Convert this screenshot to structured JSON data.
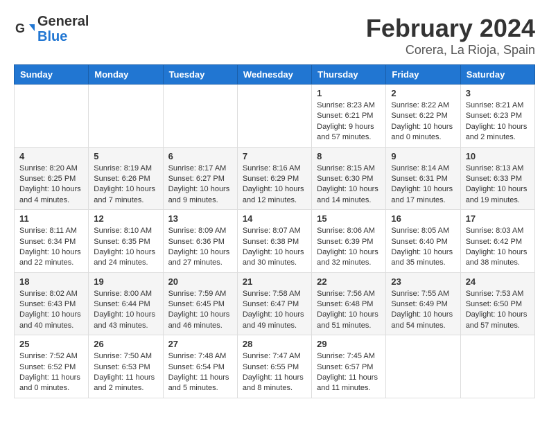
{
  "logo": {
    "line1": "General",
    "line2": "Blue"
  },
  "title": "February 2024",
  "subtitle": "Corera, La Rioja, Spain",
  "days_of_week": [
    "Sunday",
    "Monday",
    "Tuesday",
    "Wednesday",
    "Thursday",
    "Friday",
    "Saturday"
  ],
  "weeks": [
    [
      {
        "date": "",
        "info": ""
      },
      {
        "date": "",
        "info": ""
      },
      {
        "date": "",
        "info": ""
      },
      {
        "date": "",
        "info": ""
      },
      {
        "date": "1",
        "info": "Sunrise: 8:23 AM\nSunset: 6:21 PM\nDaylight: 9 hours and 57 minutes."
      },
      {
        "date": "2",
        "info": "Sunrise: 8:22 AM\nSunset: 6:22 PM\nDaylight: 10 hours and 0 minutes."
      },
      {
        "date": "3",
        "info": "Sunrise: 8:21 AM\nSunset: 6:23 PM\nDaylight: 10 hours and 2 minutes."
      }
    ],
    [
      {
        "date": "4",
        "info": "Sunrise: 8:20 AM\nSunset: 6:25 PM\nDaylight: 10 hours and 4 minutes."
      },
      {
        "date": "5",
        "info": "Sunrise: 8:19 AM\nSunset: 6:26 PM\nDaylight: 10 hours and 7 minutes."
      },
      {
        "date": "6",
        "info": "Sunrise: 8:17 AM\nSunset: 6:27 PM\nDaylight: 10 hours and 9 minutes."
      },
      {
        "date": "7",
        "info": "Sunrise: 8:16 AM\nSunset: 6:29 PM\nDaylight: 10 hours and 12 minutes."
      },
      {
        "date": "8",
        "info": "Sunrise: 8:15 AM\nSunset: 6:30 PM\nDaylight: 10 hours and 14 minutes."
      },
      {
        "date": "9",
        "info": "Sunrise: 8:14 AM\nSunset: 6:31 PM\nDaylight: 10 hours and 17 minutes."
      },
      {
        "date": "10",
        "info": "Sunrise: 8:13 AM\nSunset: 6:33 PM\nDaylight: 10 hours and 19 minutes."
      }
    ],
    [
      {
        "date": "11",
        "info": "Sunrise: 8:11 AM\nSunset: 6:34 PM\nDaylight: 10 hours and 22 minutes."
      },
      {
        "date": "12",
        "info": "Sunrise: 8:10 AM\nSunset: 6:35 PM\nDaylight: 10 hours and 24 minutes."
      },
      {
        "date": "13",
        "info": "Sunrise: 8:09 AM\nSunset: 6:36 PM\nDaylight: 10 hours and 27 minutes."
      },
      {
        "date": "14",
        "info": "Sunrise: 8:07 AM\nSunset: 6:38 PM\nDaylight: 10 hours and 30 minutes."
      },
      {
        "date": "15",
        "info": "Sunrise: 8:06 AM\nSunset: 6:39 PM\nDaylight: 10 hours and 32 minutes."
      },
      {
        "date": "16",
        "info": "Sunrise: 8:05 AM\nSunset: 6:40 PM\nDaylight: 10 hours and 35 minutes."
      },
      {
        "date": "17",
        "info": "Sunrise: 8:03 AM\nSunset: 6:42 PM\nDaylight: 10 hours and 38 minutes."
      }
    ],
    [
      {
        "date": "18",
        "info": "Sunrise: 8:02 AM\nSunset: 6:43 PM\nDaylight: 10 hours and 40 minutes."
      },
      {
        "date": "19",
        "info": "Sunrise: 8:00 AM\nSunset: 6:44 PM\nDaylight: 10 hours and 43 minutes."
      },
      {
        "date": "20",
        "info": "Sunrise: 7:59 AM\nSunset: 6:45 PM\nDaylight: 10 hours and 46 minutes."
      },
      {
        "date": "21",
        "info": "Sunrise: 7:58 AM\nSunset: 6:47 PM\nDaylight: 10 hours and 49 minutes."
      },
      {
        "date": "22",
        "info": "Sunrise: 7:56 AM\nSunset: 6:48 PM\nDaylight: 10 hours and 51 minutes."
      },
      {
        "date": "23",
        "info": "Sunrise: 7:55 AM\nSunset: 6:49 PM\nDaylight: 10 hours and 54 minutes."
      },
      {
        "date": "24",
        "info": "Sunrise: 7:53 AM\nSunset: 6:50 PM\nDaylight: 10 hours and 57 minutes."
      }
    ],
    [
      {
        "date": "25",
        "info": "Sunrise: 7:52 AM\nSunset: 6:52 PM\nDaylight: 11 hours and 0 minutes."
      },
      {
        "date": "26",
        "info": "Sunrise: 7:50 AM\nSunset: 6:53 PM\nDaylight: 11 hours and 2 minutes."
      },
      {
        "date": "27",
        "info": "Sunrise: 7:48 AM\nSunset: 6:54 PM\nDaylight: 11 hours and 5 minutes."
      },
      {
        "date": "28",
        "info": "Sunrise: 7:47 AM\nSunset: 6:55 PM\nDaylight: 11 hours and 8 minutes."
      },
      {
        "date": "29",
        "info": "Sunrise: 7:45 AM\nSunset: 6:57 PM\nDaylight: 11 hours and 11 minutes."
      },
      {
        "date": "",
        "info": ""
      },
      {
        "date": "",
        "info": ""
      }
    ]
  ]
}
